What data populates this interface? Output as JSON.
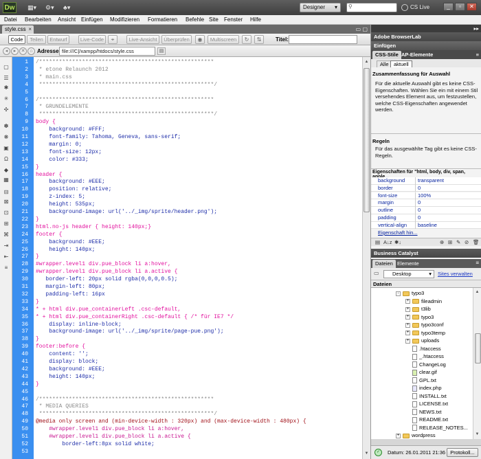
{
  "app": {
    "logo": "Dw",
    "workspace": "Designer",
    "cs_live": "CS Live"
  },
  "menu": [
    "Datei",
    "Bearbeiten",
    "Ansicht",
    "Einfügen",
    "Modifizieren",
    "Formatieren",
    "Befehle",
    "Site",
    "Fenster",
    "Hilfe"
  ],
  "document": {
    "tab": "style.css",
    "views": {
      "code": "Code",
      "split": "Teilen",
      "design": "Entwurf",
      "live_code": "Live-Code",
      "live_view": "Live-Ansicht",
      "check": "Überprüfen",
      "multiscreen": "Multiscreen"
    },
    "title_label": "Titel:",
    "address_label": "Adresse:",
    "address": "file:///C|/xampp/htdocs/style.css"
  },
  "code": {
    "line_numbers": [
      "1",
      "2",
      "3",
      "4",
      "5",
      "6",
      "7",
      "8",
      "9",
      "10",
      "11",
      "12",
      "13",
      "14",
      "15",
      "16",
      "17",
      "18",
      "19",
      "20",
      "21",
      "22",
      "23",
      "24",
      "25",
      "26",
      "27",
      "28",
      "29",
      "30",
      "31",
      "32",
      "33",
      "34",
      "35",
      "36",
      "37",
      "38",
      "39",
      "40",
      "41",
      "42",
      "43",
      "44",
      "45",
      "46",
      "47",
      "48",
      "49",
      "50",
      "51",
      "52",
      "53"
    ],
    "lines": [
      {
        "text": "/*****************************************************",
        "cls": "c-comment"
      },
      {
        "text": " * etone Relaunch 2012",
        "cls": "c-comment"
      },
      {
        "text": " * main.css",
        "cls": "c-comment"
      },
      {
        "text": " *****************************************************/",
        "cls": "c-comment"
      },
      {
        "text": "",
        "cls": ""
      },
      {
        "text": "/*****************************************************",
        "cls": "c-comment"
      },
      {
        "text": " * GRUNDELEMENTE",
        "cls": "c-comment"
      },
      {
        "text": " *****************************************************/",
        "cls": "c-comment"
      },
      {
        "text": "body {",
        "cls": "c-sel"
      },
      {
        "text": "    background: #FFF;",
        "cls": "c-prop"
      },
      {
        "text": "    font-family: Tahoma, Geneva, sans-serif;",
        "cls": "c-prop"
      },
      {
        "text": "    margin: 0;",
        "cls": "c-prop"
      },
      {
        "text": "    font-size: 12px;",
        "cls": "c-prop"
      },
      {
        "text": "    color: #333;",
        "cls": "c-prop"
      },
      {
        "text": "}",
        "cls": "c-sel"
      },
      {
        "text": "header {",
        "cls": "c-sel"
      },
      {
        "text": "    background: #EEE;",
        "cls": "c-prop"
      },
      {
        "text": "    position: relative;",
        "cls": "c-prop"
      },
      {
        "text": "    z-index: 5;",
        "cls": "c-prop"
      },
      {
        "text": "    height: 535px;",
        "cls": "c-prop"
      },
      {
        "text": "    background-image: url('../_img/sprite/header.png');",
        "cls": "c-prop"
      },
      {
        "text": "}",
        "cls": "c-sel"
      },
      {
        "text": "html.no-js header { height: 140px;}",
        "cls": "c-sel"
      },
      {
        "text": "footer {",
        "cls": "c-sel"
      },
      {
        "text": "    background: #EEE;",
        "cls": "c-prop"
      },
      {
        "text": "    height: 140px;",
        "cls": "c-prop"
      },
      {
        "text": "}",
        "cls": "c-sel"
      },
      {
        "text": "#wrapper.level1 div.pue_block li a:hover,",
        "cls": "c-sel"
      },
      {
        "text": "#wrapper.level1 div.pue_block li a.active {",
        "cls": "c-sel"
      },
      {
        "text": "   border-left: 20px solid rgba(0,0,0,0.5);",
        "cls": "c-prop"
      },
      {
        "text": "   margin-left: 80px;",
        "cls": "c-prop"
      },
      {
        "text": "   padding-left: 16px",
        "cls": "c-prop"
      },
      {
        "text": "}",
        "cls": "c-sel"
      },
      {
        "text": "* + html div.pue_containerLeft .csc-default,",
        "cls": "c-sel"
      },
      {
        "text": "* + html div.pue_containerRight .csc-default { /* für IE7 */",
        "cls": "c-sel"
      },
      {
        "text": "    display: inline-block;",
        "cls": "c-prop"
      },
      {
        "text": "    background-image: url('../_img/sprite/page-pue.png');",
        "cls": "c-prop"
      },
      {
        "text": "}",
        "cls": "c-sel"
      },
      {
        "text": "footer:before {",
        "cls": "c-sel"
      },
      {
        "text": "    content: '';",
        "cls": "c-prop"
      },
      {
        "text": "    display: block;",
        "cls": "c-prop"
      },
      {
        "text": "    background: #EEE;",
        "cls": "c-prop"
      },
      {
        "text": "    height: 140px;",
        "cls": "c-prop"
      },
      {
        "text": "}",
        "cls": "c-sel"
      },
      {
        "text": "",
        "cls": ""
      },
      {
        "text": "/*****************************************************",
        "cls": "c-comment"
      },
      {
        "text": " * MEDIA QUERIES",
        "cls": "c-comment"
      },
      {
        "text": " *****************************************************/",
        "cls": "c-comment"
      },
      {
        "text": "@media only screen and (min-device-width : 320px) and (max-device-width : 480px) {",
        "cls": "c-media"
      },
      {
        "text": "    #wrapper.level1 div.pue_block li a:hover,",
        "cls": "c-media-sel"
      },
      {
        "text": "    #wrapper.level1 div.pue_block li a.active {",
        "cls": "c-media-sel"
      },
      {
        "text": "        border-left:8px solid white;",
        "cls": "c-prop"
      },
      {
        "text": "",
        "cls": ""
      }
    ]
  },
  "panels": {
    "browserlab": "Adobe BrowserLab",
    "insert": "Einfügen",
    "css_tab": "CSS-Stile",
    "ap_tab": "AP-Elemente",
    "toggle_all": "Alle",
    "toggle_current": "aktuell",
    "summary_title": "Zusammenfassung für Auswahl",
    "summary_text": "Für die aktuelle Auswahl gibt es keine CSS-Eigenschaften. Wählen Sie ein mit einem Stil versehendes Element aus, um festzustellen, welche CSS-Eigenschaften angewendet werden.",
    "rules_title": "Regeln",
    "rules_text": "Für das ausgewählte Tag gibt es keine CSS-Regeln.",
    "props_title": "Eigenschaften für \"html, body, div, span, apple...",
    "props": [
      {
        "name": "background",
        "value": "transparent"
      },
      {
        "name": "border",
        "value": "0"
      },
      {
        "name": "font-size",
        "value": "100%"
      },
      {
        "name": "margin",
        "value": "0"
      },
      {
        "name": "outline",
        "value": "0"
      },
      {
        "name": "padding",
        "value": "0"
      },
      {
        "name": "vertical-align",
        "value": "baseline"
      }
    ],
    "add_prop": "Eigenschaft hin...",
    "business_catalyst": "Business Catalyst",
    "files_tab": "Dateien",
    "assets_tab": "Elemente",
    "site": "Desktop",
    "manage_sites": "Sites verwalten",
    "tree_header": "Dateien",
    "tree": [
      {
        "name": "typo3",
        "type": "folder",
        "depth": 0,
        "exp": "-"
      },
      {
        "name": "fileadmin",
        "type": "folder",
        "depth": 1,
        "exp": "+"
      },
      {
        "name": "t3lib",
        "type": "folder",
        "depth": 1,
        "exp": "+"
      },
      {
        "name": "typo3",
        "type": "folder",
        "depth": 1,
        "exp": "+"
      },
      {
        "name": "typo3conf",
        "type": "folder",
        "depth": 1,
        "exp": "+"
      },
      {
        "name": "typo3temp",
        "type": "folder",
        "depth": 1,
        "exp": "+"
      },
      {
        "name": "uploads",
        "type": "folder",
        "depth": 1,
        "exp": "+"
      },
      {
        "name": ".htaccess",
        "type": "file",
        "depth": 1,
        "exp": ""
      },
      {
        "name": "_.htaccess",
        "type": "file",
        "depth": 1,
        "exp": ""
      },
      {
        "name": "ChangeLog",
        "type": "file",
        "depth": 1,
        "exp": ""
      },
      {
        "name": "clear.gif",
        "type": "img",
        "depth": 1,
        "exp": ""
      },
      {
        "name": "GPL.txt",
        "type": "file",
        "depth": 1,
        "exp": ""
      },
      {
        "name": "index.php",
        "type": "php",
        "depth": 1,
        "exp": ""
      },
      {
        "name": "INSTALL.txt",
        "type": "file",
        "depth": 1,
        "exp": ""
      },
      {
        "name": "LICENSE.txt",
        "type": "file",
        "depth": 1,
        "exp": ""
      },
      {
        "name": "NEWS.txt",
        "type": "file",
        "depth": 1,
        "exp": ""
      },
      {
        "name": "README.txt",
        "type": "file",
        "depth": 1,
        "exp": ""
      },
      {
        "name": "RELEASE_NOTES...",
        "type": "file",
        "depth": 1,
        "exp": ""
      },
      {
        "name": "wordpress",
        "type": "folder",
        "depth": 0,
        "exp": "+"
      }
    ],
    "date": "Datum: 26.01.2011 21:36",
    "protocol": "Protokoll..."
  }
}
